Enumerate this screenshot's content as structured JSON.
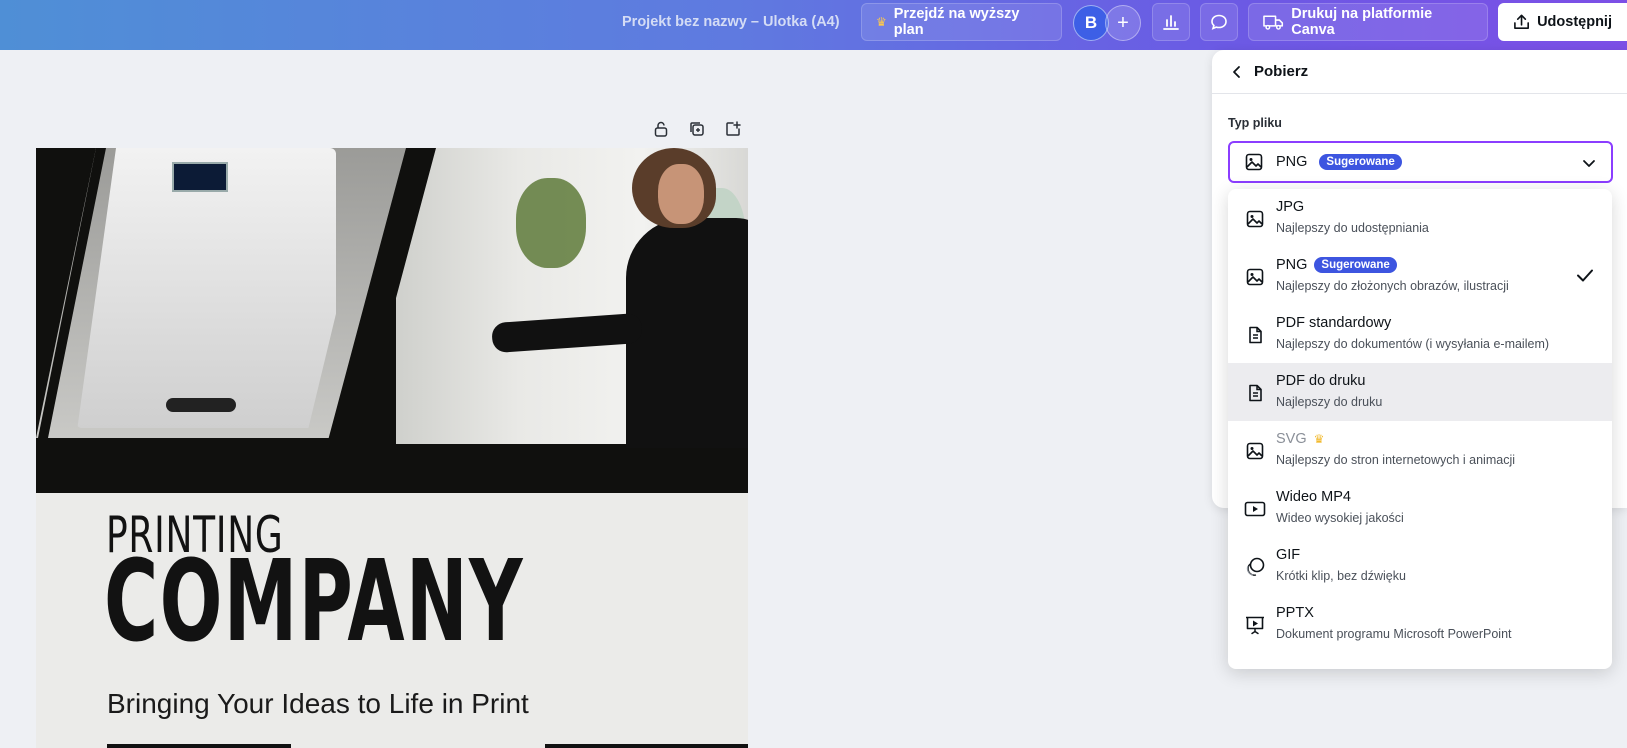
{
  "header": {
    "doc_title": "Projekt bez nazwy – Ulotka (A4)",
    "upgrade_label": "Przejdź na wyższy plan",
    "avatar_initial": "B",
    "print_label": "Drukuj na platformie Canva",
    "share_label": "Udostępnij"
  },
  "canvas": {
    "title_line1": "PRINTING",
    "title_line2": "COMPANY",
    "tagline": "Bringing Your Ideas to Life in Print"
  },
  "panel": {
    "back_label": "Pobierz",
    "file_type_label": "Typ pliku",
    "selected_value": "PNG",
    "selected_badge": "Sugerowane"
  },
  "options": [
    {
      "title": "JPG",
      "desc": "Najlepszy do udostępniania",
      "icon": "image-icon"
    },
    {
      "title": "PNG",
      "badge": "Sugerowane",
      "desc": "Najlepszy do złożonych obrazów, ilustracji",
      "icon": "image-icon",
      "selected": true
    },
    {
      "title": "PDF standardowy",
      "desc": "Najlepszy do dokumentów (i wysyłania e-mailem)",
      "icon": "document-icon"
    },
    {
      "title": "PDF do druku",
      "desc": "Najlepszy do druku",
      "icon": "document-icon"
    },
    {
      "title": "SVG",
      "desc": "Najlepszy do stron internetowych i animacji",
      "icon": "image-icon",
      "premium": true
    },
    {
      "title": "Wideo MP4",
      "desc": "Wideo wysokiej jakości",
      "icon": "video-icon"
    },
    {
      "title": "GIF",
      "desc": "Krótki klip, bez dźwięku",
      "icon": "gif-icon"
    },
    {
      "title": "PPTX",
      "desc": "Dokument programu Microsoft PowerPoint",
      "icon": "presentation-icon"
    }
  ],
  "colors": {
    "accent": "#8b3dff",
    "badge": "#3d55e0",
    "crown": "#ffc94a"
  }
}
